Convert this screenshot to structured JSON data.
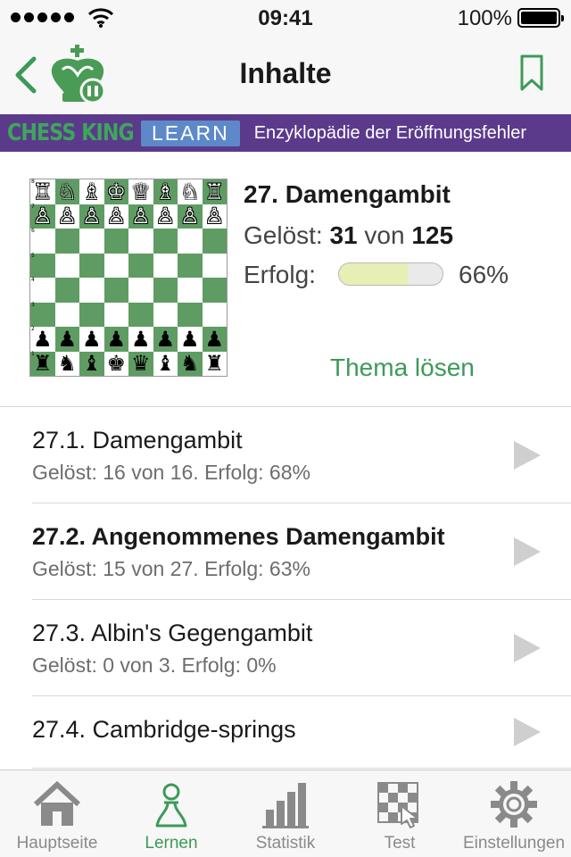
{
  "status_bar": {
    "time": "09:41",
    "battery": "100%"
  },
  "nav": {
    "title": "Inhalte",
    "back_icon": "chevron-left-icon",
    "logo_icon": "chess-king-logo-icon",
    "bookmark_icon": "bookmark-icon"
  },
  "banner": {
    "brand": "CHESS KING",
    "badge": "LEARN",
    "subtitle": "Enzyklopädie der Eröffnungsfehler"
  },
  "topic": {
    "title": "27. Damengambit",
    "solved_prefix": "Gelöst: ",
    "solved_count": "31",
    "solved_mid": " von ",
    "solved_total": "125",
    "success_label": "Erfolg:",
    "success_value": "66%",
    "success_fraction": 0.66,
    "solve_button": "Thema lösen",
    "board": {
      "ranks": [
        "8",
        "7",
        "6",
        "5",
        "4",
        "3",
        "2",
        "1"
      ],
      "rows": [
        [
          "♖",
          "♘",
          "♗",
          "♔",
          "♕",
          "♗",
          "♘",
          "♖"
        ],
        [
          "♙",
          "♙",
          "♙",
          "♙",
          "♙",
          "♙",
          "♙",
          "♙"
        ],
        [
          "",
          "",
          "",
          "",
          "",
          "",
          "",
          ""
        ],
        [
          "",
          "",
          "",
          "",
          "",
          "",
          "",
          ""
        ],
        [
          "",
          "",
          "",
          "",
          "",
          "",
          "",
          ""
        ],
        [
          "",
          "",
          "",
          "",
          "",
          "",
          "",
          ""
        ],
        [
          "♟",
          "♟",
          "♟",
          "♟",
          "♟",
          "♟",
          "♟",
          "♟"
        ],
        [
          "♜",
          "♞",
          "♝",
          "♚",
          "♛",
          "♝",
          "♞",
          "♜"
        ]
      ],
      "colors": [
        "white",
        "white",
        "",
        "",
        "",
        "",
        "black",
        "black"
      ]
    }
  },
  "items": [
    {
      "title": "27.1. Damengambit",
      "bold": false,
      "subtitle": "Gelöst: 16 von 16. Erfolg: 68%"
    },
    {
      "title": "27.2. Angenommenes Damengambit",
      "bold": true,
      "subtitle": "Gelöst: 15 von 27. Erfolg: 63%"
    },
    {
      "title": "27.3. Albin's Gegengambit",
      "bold": false,
      "subtitle": "Gelöst: 0 von 3. Erfolg: 0%"
    },
    {
      "title": "27.4. Cambridge-springs",
      "bold": false,
      "subtitle": ""
    }
  ],
  "tabs": [
    {
      "label": "Hauptseite",
      "icon": "home-icon",
      "active": false
    },
    {
      "label": "Lernen",
      "icon": "pawn-icon",
      "active": true
    },
    {
      "label": "Statistik",
      "icon": "bar-chart-icon",
      "active": false
    },
    {
      "label": "Test",
      "icon": "board-tap-icon",
      "active": false
    },
    {
      "label": "Einstellungen",
      "icon": "gear-icon",
      "active": false
    }
  ],
  "colors": {
    "accent_green": "#3c9a59",
    "banner_purple": "#5b3a8c",
    "board_dark": "#5f9c63",
    "progress_fill": "#e8efb4"
  }
}
